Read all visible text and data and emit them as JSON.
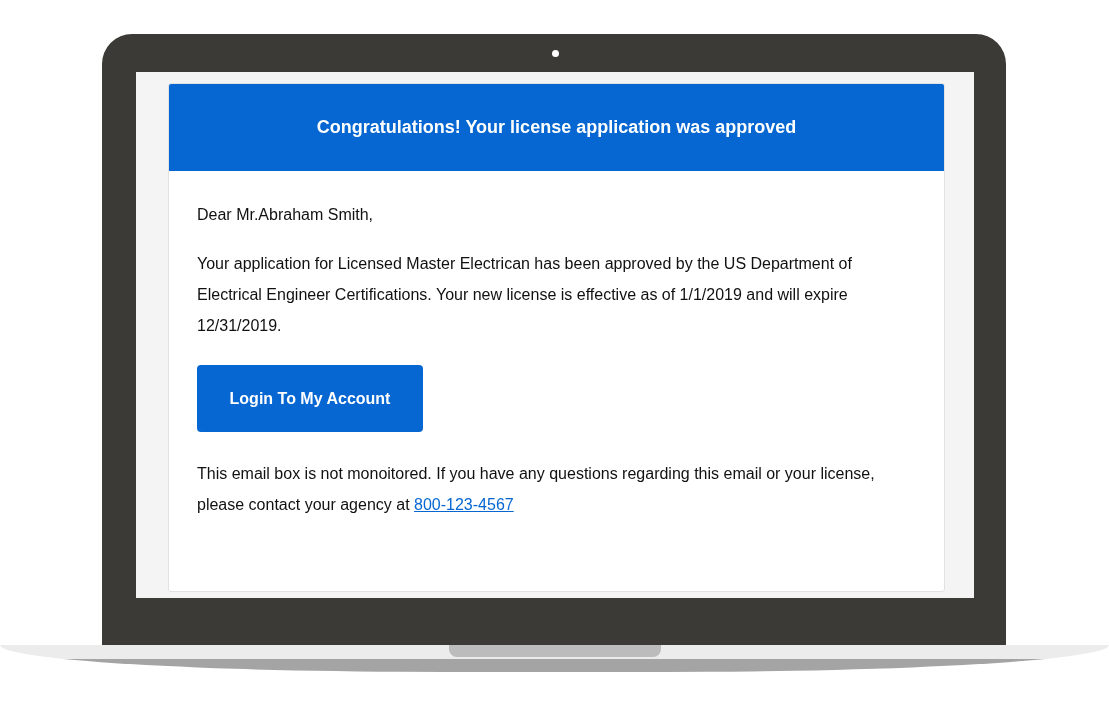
{
  "email": {
    "header": "Congratulations! Your license application was approved",
    "greeting": "Dear Mr.Abraham Smith,",
    "message": "Your application for Licensed Master Electrican has been approved by the US Department of Electrical Engineer Certifications. Your new license is effective as of 1/1/2019 and will expire 12/31/2019.",
    "button": "Login To My Account",
    "footer_text": "This email box is not monoitored. If you have any questions regarding this email or your license, please contact your agency at",
    "phone_link": "800-123-4567"
  }
}
